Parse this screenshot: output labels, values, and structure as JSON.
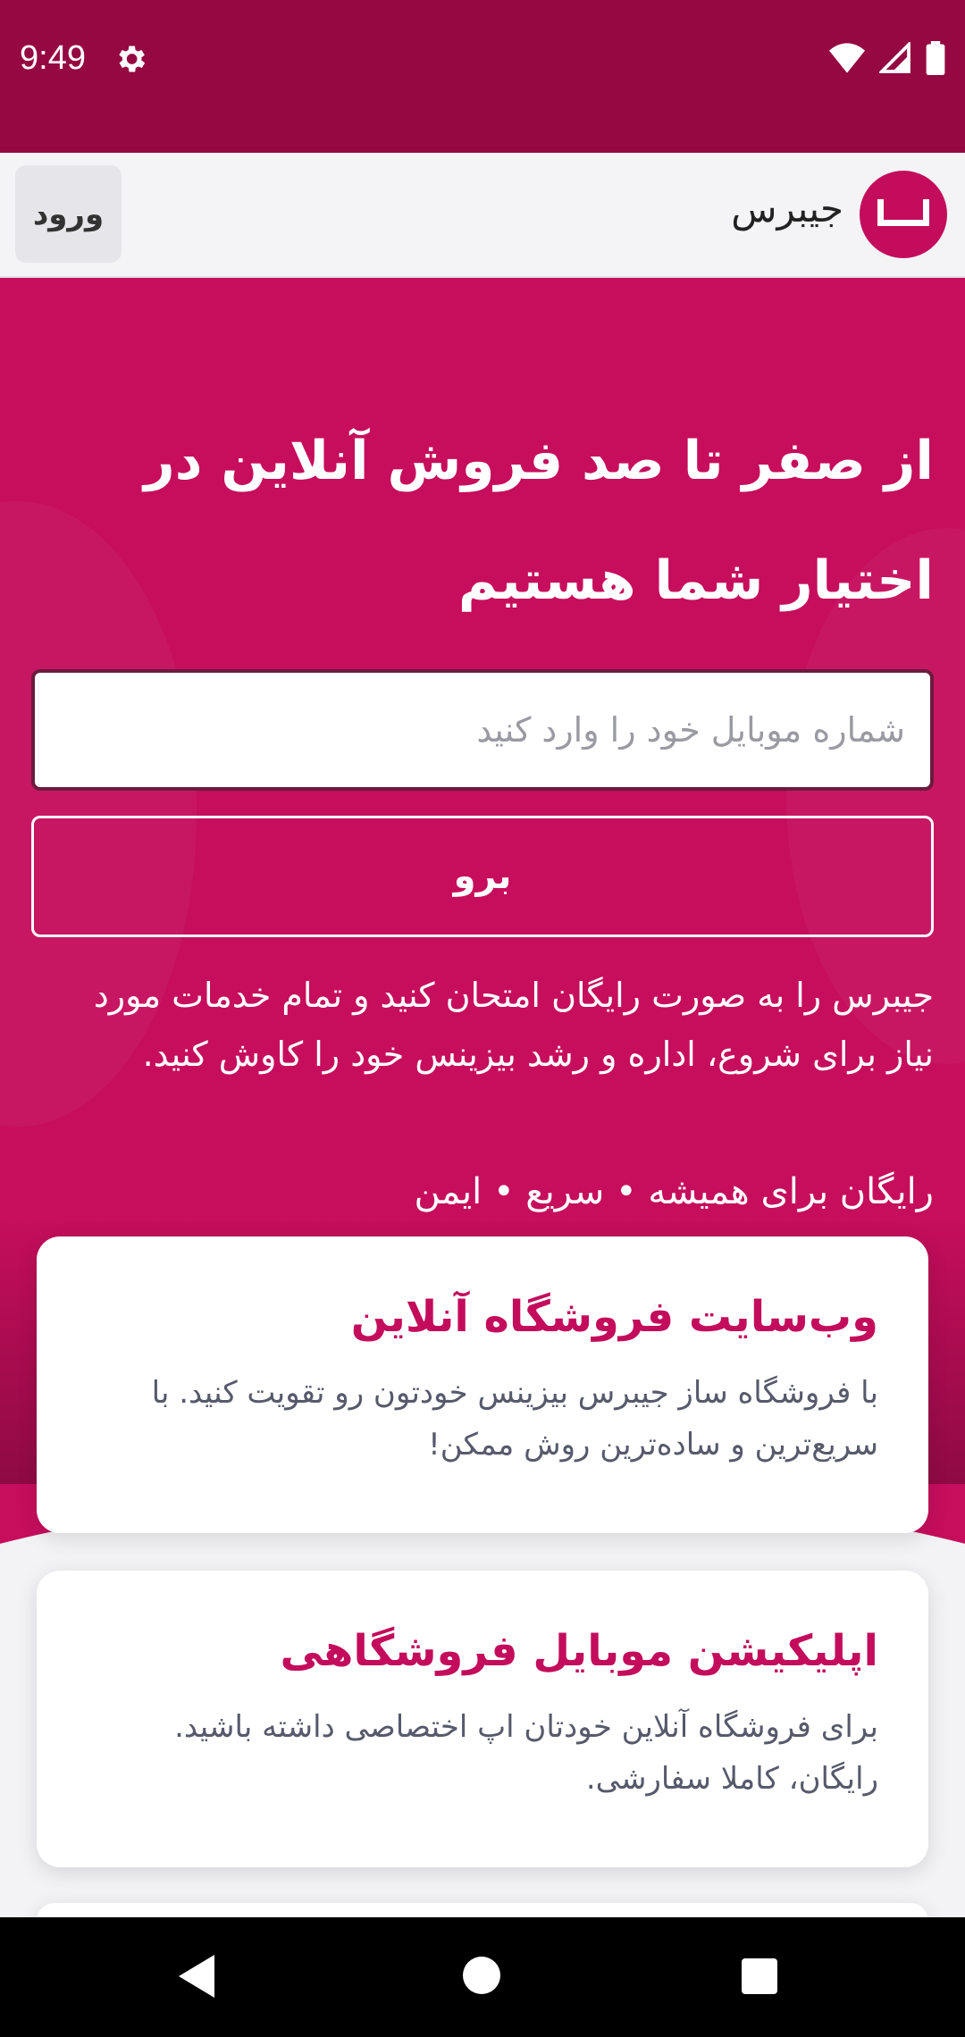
{
  "status_bar": {
    "time": "9:49"
  },
  "header": {
    "brand": "جیبرس",
    "login_label": "ورود"
  },
  "hero": {
    "title": "از صفر تا صد فروش آنلاین در اختیار شما هستیم",
    "phone_placeholder": "شماره موبایل خود را وارد کنید",
    "go_label": "برو",
    "description": "جیبرس را به صورت رایگان امتحان کنید و تمام خدمات مورد نیاز برای شروع، اداره و رشد بیزینس خود را کاوش کنید.",
    "tagline": "رایگان برای همیشه • سریع • ایمن"
  },
  "cards": [
    {
      "title": "وب‌سایت فروشگاه آنلاین",
      "description": "با فروشگاه ساز جیبرس بیزینس خودتون رو تقویت کنید. با سریع‌ترین و ساده‌ترین روش ممکن!"
    },
    {
      "title": "اپلیکیشن موبایل فروشگاهی",
      "description": "برای فروشگاه آنلاین خودتان اپ اختصاصی داشته باشید. رایگان، کاملا سفارشی."
    }
  ],
  "colors": {
    "brand": "#c60e5c",
    "status_bar": "#950842",
    "card_title": "#c30d5c"
  }
}
